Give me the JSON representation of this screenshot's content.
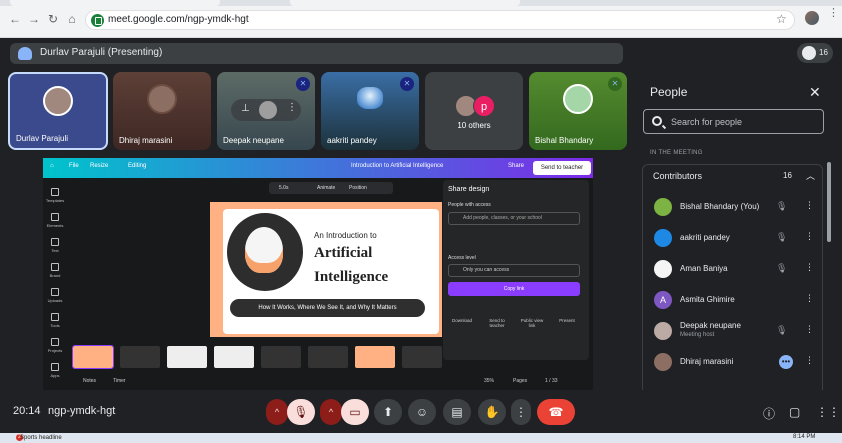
{
  "browser": {
    "url": "meet.google.com/ngp-ymdk-hgt",
    "nav": {
      "back": "←",
      "forward": "→",
      "reload": "↻",
      "home": "⌂"
    },
    "star": "☆",
    "menu": "⋮",
    "icons": [
      "back-arrow-icon",
      "forward-arrow-icon",
      "reload-icon",
      "home-icon",
      "site-settings-icon",
      "star-icon",
      "profile-avatar",
      "kebab-menu-icon"
    ]
  },
  "meet": {
    "presenter_label": "Durlav Parajuli (Presenting)",
    "participant_count": "16",
    "tiles": [
      {
        "name": "Durlav Parajuli"
      },
      {
        "name": "Dhiraj marasini"
      },
      {
        "name": "Deepak neupane"
      },
      {
        "name": "aakriti pandey"
      },
      {
        "name": "10 others"
      },
      {
        "name": "Bishal Bhandary"
      }
    ],
    "others_avatar_letter": "p",
    "mic_off_glyph": "✕",
    "pin_glyph": "⊥",
    "more_glyph": "⋮",
    "accent_color": "#8ab4f8",
    "end_call_color": "#ea4335"
  },
  "shared_screen": {
    "canva": {
      "menu": [
        "File",
        "Resize",
        "Editing"
      ],
      "doc_title": "Introduction to Artificial Intelligence",
      "share": "Share",
      "send_to_teacher": "Send to teacher",
      "toolbar": {
        "duration": "5.0s",
        "animate": "Animate",
        "position": "Position"
      },
      "sidebar": [
        "Templates",
        "Elements",
        "Text",
        "Brand",
        "Uploads",
        "Tools",
        "Projects",
        "Apps"
      ],
      "slide": {
        "line1": "An Introduction to",
        "line2": "Artificial",
        "line3": "Intelligence",
        "subtitle": "How It Works, Where We See It, and Why It Matters"
      },
      "bottom": {
        "notes": "Notes",
        "timer": "Timer",
        "zoom": "35%",
        "pages": "Pages",
        "page": "1 / 33"
      },
      "share_panel": {
        "title": "Share design",
        "people_with_access": "People with access",
        "add_placeholder": "Add people, classes, or your school",
        "access_level": "Access level",
        "access_value": "Only you can access",
        "copy_link": "Copy link",
        "options": [
          "Download",
          "Send to teacher",
          "Public view link",
          "Present"
        ]
      }
    }
  },
  "people_panel": {
    "title": "People",
    "search_placeholder": "Search for people",
    "section": "IN THE MEETING",
    "group_label": "Contributors",
    "group_count": "16",
    "rows": [
      {
        "name": "Bishal Bhandary (You)",
        "sub": ""
      },
      {
        "name": "aakriti pandey",
        "sub": ""
      },
      {
        "name": "Aman Baniya",
        "sub": ""
      },
      {
        "name": "Asmita Ghimire",
        "sub": "",
        "initial": "A"
      },
      {
        "name": "Deepak neupane",
        "sub": "Meeting host"
      },
      {
        "name": "Dhiraj marasini",
        "sub": ""
      }
    ]
  },
  "controls": {
    "time": "20:14",
    "meeting_code": "ngp-ymdk-hgt",
    "chevron": "^"
  },
  "taskbar": {
    "badge": "2",
    "news": "Sports headline",
    "time": "8:14 PM"
  }
}
